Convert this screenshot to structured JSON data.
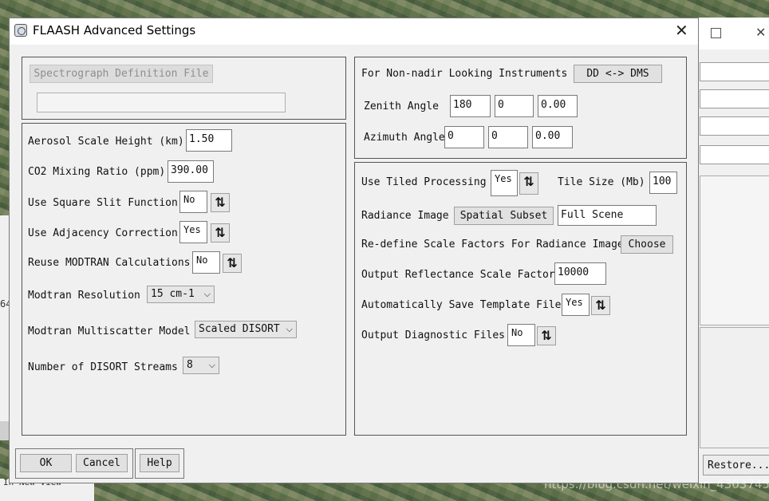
{
  "window": {
    "title": "FLAASH Advanced Settings"
  },
  "background": {
    "restore_label": "Restore...",
    "left_fragment": "64",
    "bottom_text": "In New View",
    "watermark": "https://blog.csdn.net/weixin_43037450"
  },
  "spectrograph": {
    "button_label": "Spectrograph Definition File",
    "file_value": ""
  },
  "aerosol": {
    "scale_height_label": "Aerosol Scale Height (km)",
    "scale_height_value": "1.50",
    "co2_label": "CO2 Mixing Ratio (ppm)",
    "co2_value": "390.00",
    "square_slit_label": "Use Square Slit Function",
    "square_slit_value": "No",
    "adjacency_label": "Use Adjacency Correction",
    "adjacency_value": "Yes",
    "reuse_modtran_label": "Reuse MODTRAN Calculations",
    "reuse_modtran_value": "No",
    "resolution_label": "Modtran Resolution",
    "resolution_value": "15 cm-1",
    "multiscatter_label": "Modtran Multiscatter Model",
    "multiscatter_value": "Scaled DISORT",
    "streams_label": "Number of DISORT Streams",
    "streams_value": "8"
  },
  "nonnadir": {
    "heading": "For Non-nadir Looking Instruments",
    "dd_dms_label": "DD <-> DMS",
    "zenith_label": "Zenith Angle",
    "zenith_deg": "180",
    "zenith_min": "0",
    "zenith_sec": "0.00",
    "azimuth_label": "Azimuth Angle",
    "azimuth_deg": "0",
    "azimuth_min": "0",
    "azimuth_sec": "0.00"
  },
  "processing": {
    "tiled_label": "Use Tiled Processing",
    "tiled_value": "Yes",
    "tile_size_label": "Tile Size (Mb)",
    "tile_size_value": "100",
    "radiance_label": "Radiance Image",
    "spatial_subset_label": "Spatial Subset",
    "spatial_subset_value": "Full Scene",
    "redefine_label": "Re-define Scale Factors For Radiance Image",
    "choose_label": "Choose",
    "reflectance_label": "Output Reflectance Scale Factor",
    "reflectance_value": "10000",
    "autosave_label": "Automatically Save Template File",
    "autosave_value": "Yes",
    "diagnostic_label": "Output Diagnostic Files",
    "diagnostic_value": "No"
  },
  "footer": {
    "ok_label": "OK",
    "cancel_label": "Cancel",
    "help_label": "Help"
  },
  "icons": {
    "toggle": "up-down-arrows-icon",
    "dropdown": "chevron-down-icon"
  }
}
